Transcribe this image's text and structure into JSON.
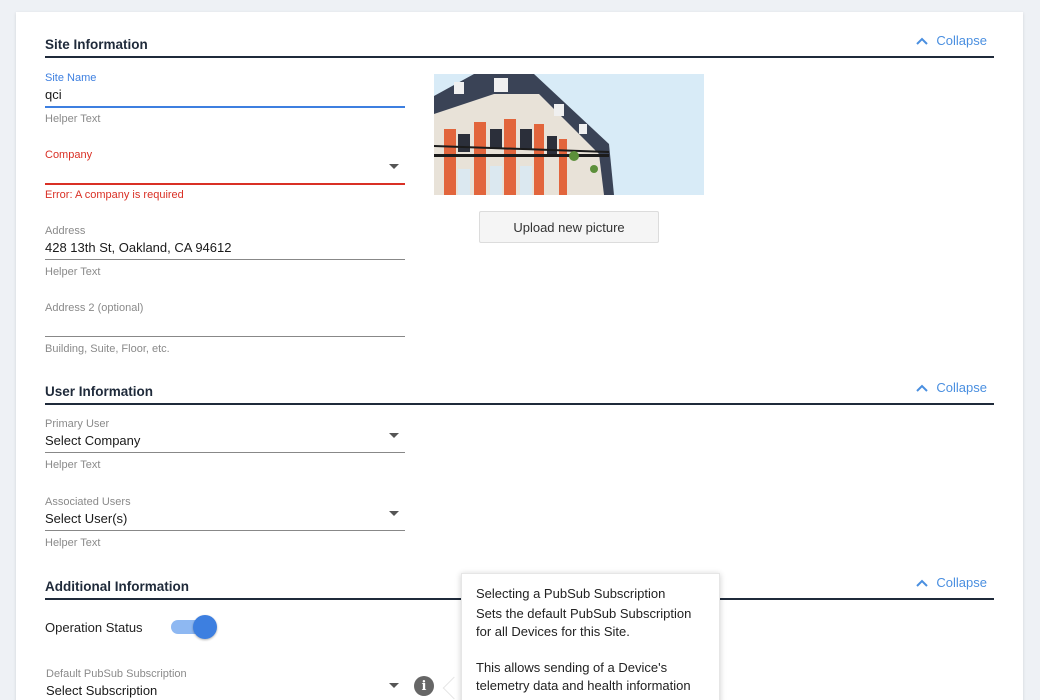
{
  "sections": {
    "site": {
      "title": "Site Information",
      "collapse": "Collapse"
    },
    "user": {
      "title": "User Information",
      "collapse": "Collapse"
    },
    "additional": {
      "title": "Additional Information",
      "collapse": "Collapse"
    }
  },
  "site_name": {
    "label": "Site Name",
    "value": "qci",
    "helper": "Helper Text"
  },
  "company": {
    "label": "Company",
    "value": "",
    "error": "Error: A company is required"
  },
  "address": {
    "label": "Address",
    "value": "428 13th St, Oakland, CA 94612",
    "helper": "Helper Text"
  },
  "address2": {
    "label": "Address 2 (optional)",
    "value": "",
    "helper": "Building, Suite, Floor, etc."
  },
  "upload_button": "Upload new picture",
  "primary_user": {
    "label": "Primary User",
    "value": "Select Company",
    "helper": "Helper Text"
  },
  "associated_users": {
    "label": "Associated Users",
    "value": "Select User(s)",
    "helper": "Helper Text"
  },
  "operation_status": {
    "label": "Operation Status",
    "on": true
  },
  "pubsub": {
    "label": "Default PubSub Subscription",
    "value": "Select Subscription"
  },
  "tooltip": {
    "title": "Selecting a PubSub Subscription",
    "line1": "Sets the default PubSub Subscription",
    "line2": "for all Devices for this Site.",
    "line3": "This allows sending of a Device's",
    "line4": "telemetry data and health information"
  },
  "colors": {
    "accent": "#4a8fe0",
    "error": "#d93025",
    "active_underline": "#3d7fe0",
    "toggle_on": "#3d7fe0"
  },
  "icons": {
    "collapse": "chevron-up-icon",
    "dropdown": "caret-down-icon",
    "info": "info-icon"
  }
}
